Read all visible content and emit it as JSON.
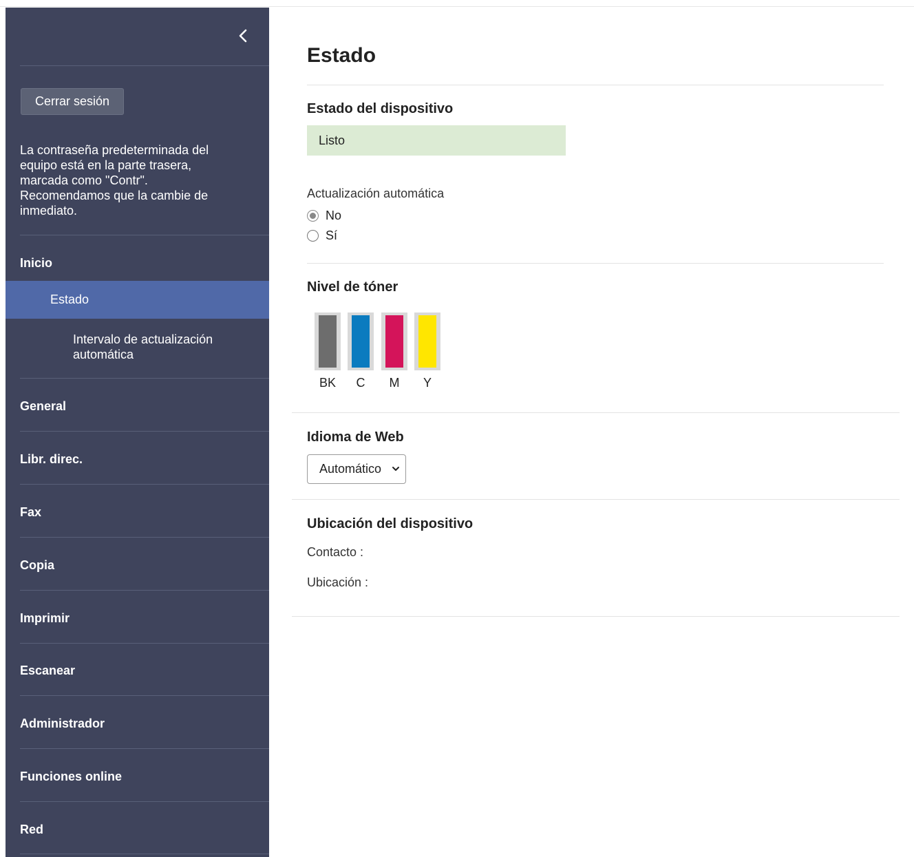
{
  "sidebar": {
    "logout_label": "Cerrar sesión",
    "password_note": "La contraseña predeterminada del equipo está en la parte trasera, marcada como \"Contr\". Recomendamos que la cambie de inmediato.",
    "items": [
      {
        "label": "Inicio"
      },
      {
        "label": "General"
      },
      {
        "label": "Libr. direc."
      },
      {
        "label": "Fax"
      },
      {
        "label": "Copia"
      },
      {
        "label": "Imprimir"
      },
      {
        "label": "Escanear"
      },
      {
        "label": "Administrador"
      },
      {
        "label": "Funciones online"
      },
      {
        "label": "Red"
      }
    ],
    "active_sub": "Estado",
    "sub_sub": "Intervalo de actualización automática",
    "collapse_icon": "chevron-left-icon"
  },
  "main": {
    "title": "Estado",
    "device_status": {
      "heading": "Estado del dispositivo",
      "value": "Listo",
      "color": "#dcebd4"
    },
    "auto_refresh": {
      "label": "Actualización automática",
      "options": [
        {
          "label": "No",
          "checked": true
        },
        {
          "label": "Sí",
          "checked": false
        }
      ]
    },
    "toner": {
      "heading": "Nivel de tóner",
      "cartridges": [
        {
          "label": "BK",
          "color": "#6d6d6d",
          "level": 1.0
        },
        {
          "label": "C",
          "color": "#0b7bbf",
          "level": 1.0
        },
        {
          "label": "M",
          "color": "#d4145a",
          "level": 1.0
        },
        {
          "label": "Y",
          "color": "#ffe600",
          "level": 1.0
        }
      ]
    },
    "web_language": {
      "heading": "Idioma de Web",
      "selected": "Automático"
    },
    "location": {
      "heading": "Ubicación del dispositivo",
      "contact_label": "Contacto :",
      "location_label": "Ubicación :"
    }
  }
}
